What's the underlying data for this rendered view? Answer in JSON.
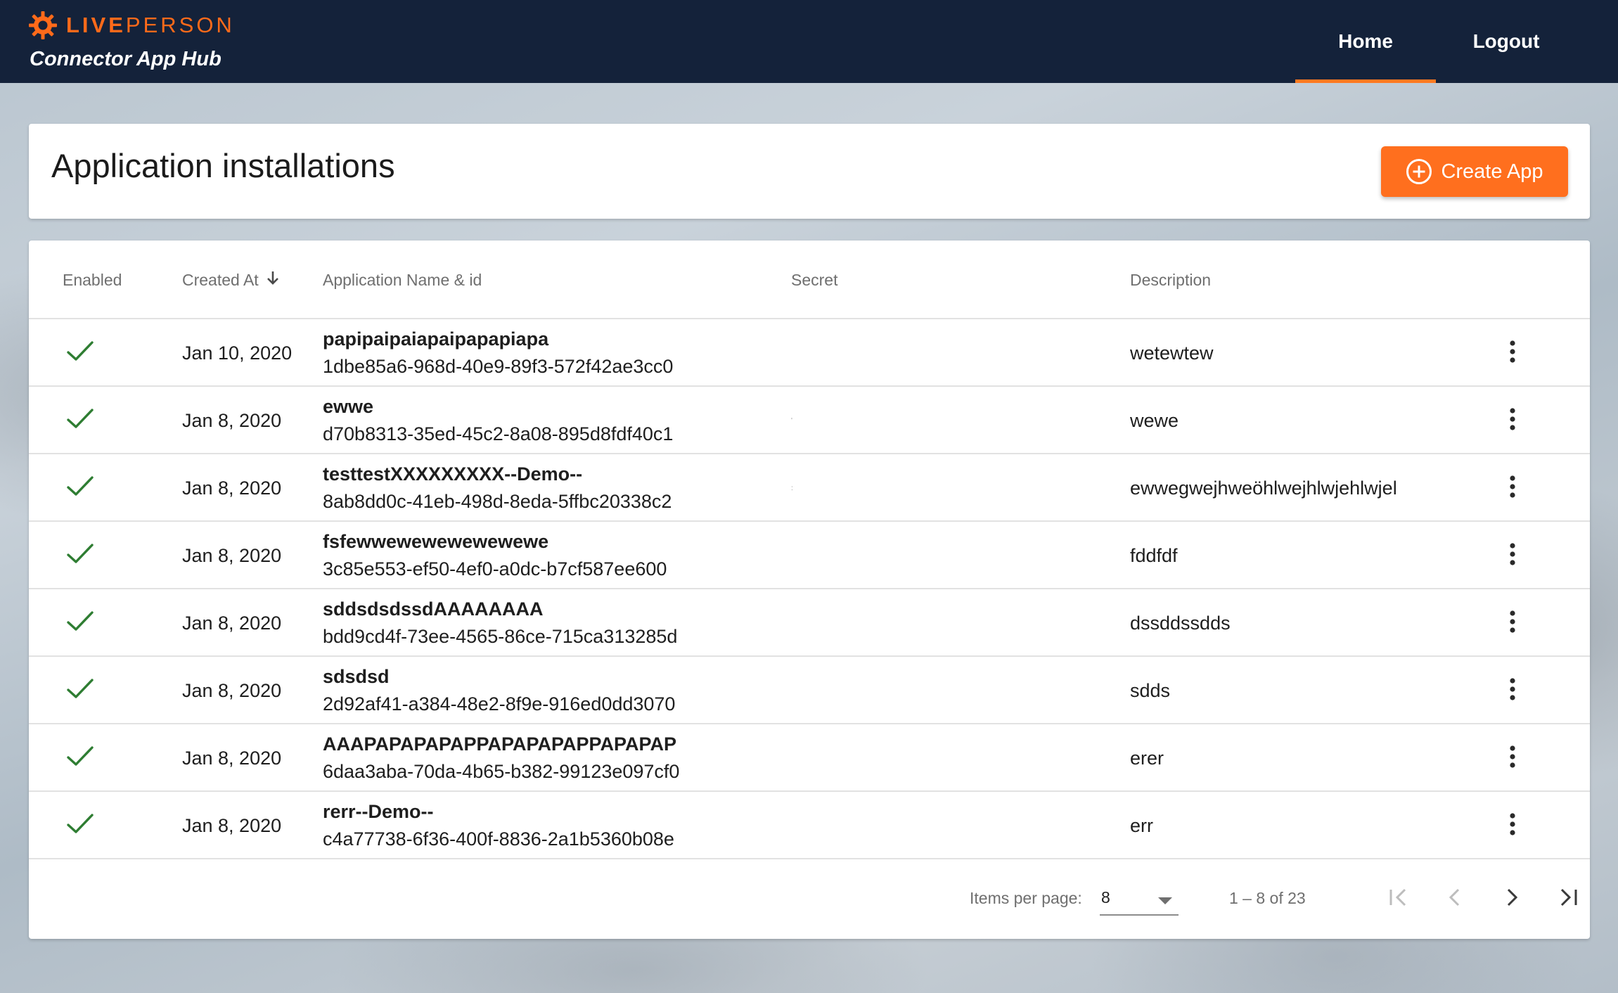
{
  "header": {
    "brand_bold": "LIVE",
    "brand_light": "PERSON",
    "app_name": "Connector App Hub",
    "nav": {
      "home": "Home",
      "logout": "Logout"
    },
    "accent_color": "#ff6f1e",
    "bar_color": "#14223a"
  },
  "page": {
    "title": "Application installations",
    "create_button": "Create App",
    "create_icon": "plus-circle-icon"
  },
  "table": {
    "columns": {
      "enabled": "Enabled",
      "created_at": "Created At",
      "name_id": "Application Name & id",
      "secret": "Secret",
      "description": "Description"
    },
    "sort_icon": "arrow-down-icon",
    "rows": [
      {
        "enabled": true,
        "created": "Jan 10, 2020",
        "name": "papipaipaiapaipapapiapa",
        "id": "1dbe85a6-968d-40e9-89f3-572f42ae3cc0",
        "secret": "",
        "description": "wetewtew"
      },
      {
        "enabled": true,
        "created": "Jan 8, 2020",
        "name": "ewwe",
        "id": "d70b8313-35ed-45c2-8a08-895d8fdf40c1",
        "secret": "'",
        "description": "wewe"
      },
      {
        "enabled": true,
        "created": "Jan 8, 2020",
        "name": "testtestXXXXXXXXX--Demo--",
        "id": "8ab8dd0c-41eb-498d-8eda-5ffbc20338c2",
        "secret": ":",
        "description": "ewwegwejhweöhlwejhlwjehlwjel"
      },
      {
        "enabled": true,
        "created": "Jan 8, 2020",
        "name": "fsfewwewewewewewewe",
        "id": "3c85e553-ef50-4ef0-a0dc-b7cf587ee600",
        "secret": "",
        "description": "fddfdf"
      },
      {
        "enabled": true,
        "created": "Jan 8, 2020",
        "name": "sddsdsdssdAAAAAAAA",
        "id": "bdd9cd4f-73ee-4565-86ce-715ca313285d",
        "secret": "",
        "description": "dssddssdds"
      },
      {
        "enabled": true,
        "created": "Jan 8, 2020",
        "name": "sdsdsd",
        "id": "2d92af41-a384-48e2-8f9e-916ed0dd3070",
        "secret": "",
        "description": "sdds"
      },
      {
        "enabled": true,
        "created": "Jan 8, 2020",
        "name": "AAAPAPAPAPAPPAPAPAPAPPAPAPAP",
        "id": "6daa3aba-70da-4b65-b382-99123e097cf0",
        "secret": "",
        "description": "erer"
      },
      {
        "enabled": true,
        "created": "Jan 8, 2020",
        "name": "rerr--Demo--",
        "id": "c4a77738-6f36-400f-8836-2a1b5360b08e",
        "secret": "",
        "description": "err"
      }
    ],
    "check_color": "#2e7d32"
  },
  "paginator": {
    "items_label": "Items per page:",
    "page_size": "8",
    "range": "1 – 8 of 23"
  }
}
